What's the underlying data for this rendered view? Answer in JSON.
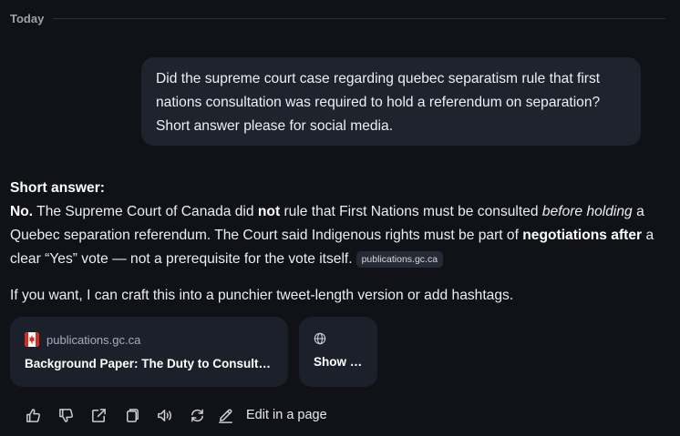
{
  "section": {
    "day": "Today"
  },
  "user_message": {
    "text": "Did the supreme court case regarding quebec separatism rule that first nations consultation was required to hold a referendum on separation? Short answer please for social media."
  },
  "assistant": {
    "heading": "Short answer:",
    "lead": "No.",
    "p1": " The Supreme Court of Canada did ",
    "bold_not": "not",
    "p2": " rule that First Nations must be consulted ",
    "italic": "before holding",
    "p3": " a Quebec separation referendum. The Court said Indigenous rights must be part of ",
    "bold_neg": "negotiations after",
    "p4": " a clear “Yes” vote — not a prerequisite for the vote itself.",
    "source_chip": "publications.gc.ca",
    "followup": "If you want, I can craft this into a punchier tweet-length version or add hashtags."
  },
  "source_card": {
    "domain": "publications.gc.ca",
    "title": "Background Paper: The Duty to Consult…",
    "favicon": "canada-flag-icon"
  },
  "show_all": {
    "label": "Show all",
    "icon": "globe-icon"
  },
  "toolbar": {
    "edit_label": "Edit in a page",
    "icons": [
      "thumbs-up-icon",
      "thumbs-down-icon",
      "share-icon",
      "copy-icon",
      "speaker-icon",
      "regenerate-icon",
      "edit-icon"
    ]
  },
  "colors": {
    "background": "#101218",
    "bubble": "#1f232d",
    "card": "#1c202a",
    "flag_red": "#d52b1e"
  }
}
